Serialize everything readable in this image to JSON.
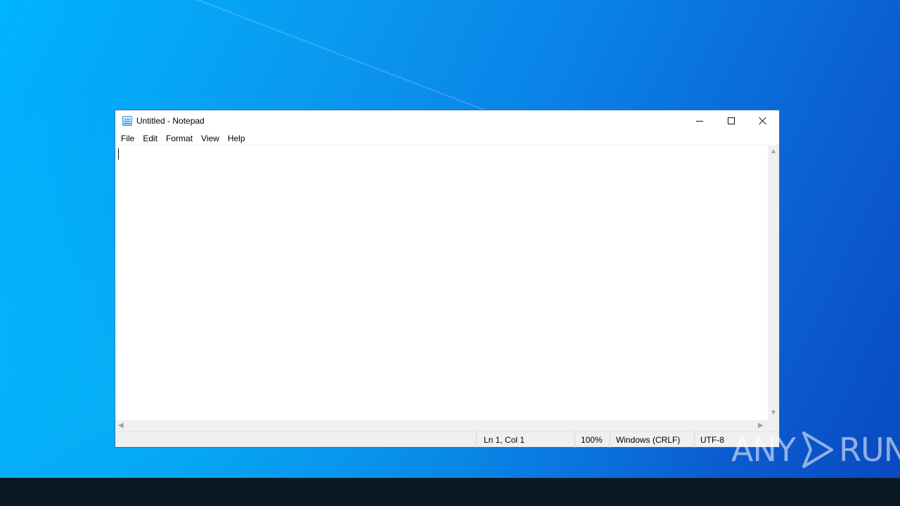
{
  "window": {
    "title": "Untitled - Notepad",
    "icon": "notepad-icon"
  },
  "titlebar_buttons": {
    "minimize": "minimize-icon",
    "maximize": "maximize-icon",
    "close": "close-icon"
  },
  "menu": {
    "items": [
      {
        "label": "File"
      },
      {
        "label": "Edit"
      },
      {
        "label": "Format"
      },
      {
        "label": "View"
      },
      {
        "label": "Help"
      }
    ]
  },
  "editor": {
    "content": ""
  },
  "status": {
    "position": "Ln 1, Col 1",
    "zoom": "100%",
    "line_ending": "Windows (CRLF)",
    "encoding": "UTF-8"
  },
  "watermark": {
    "left": "ANY",
    "right": "RUN"
  },
  "colors": {
    "desktop_accent": "#0a7fe6",
    "window_border": "#2b74c9",
    "taskbar": "#0b1a22"
  }
}
